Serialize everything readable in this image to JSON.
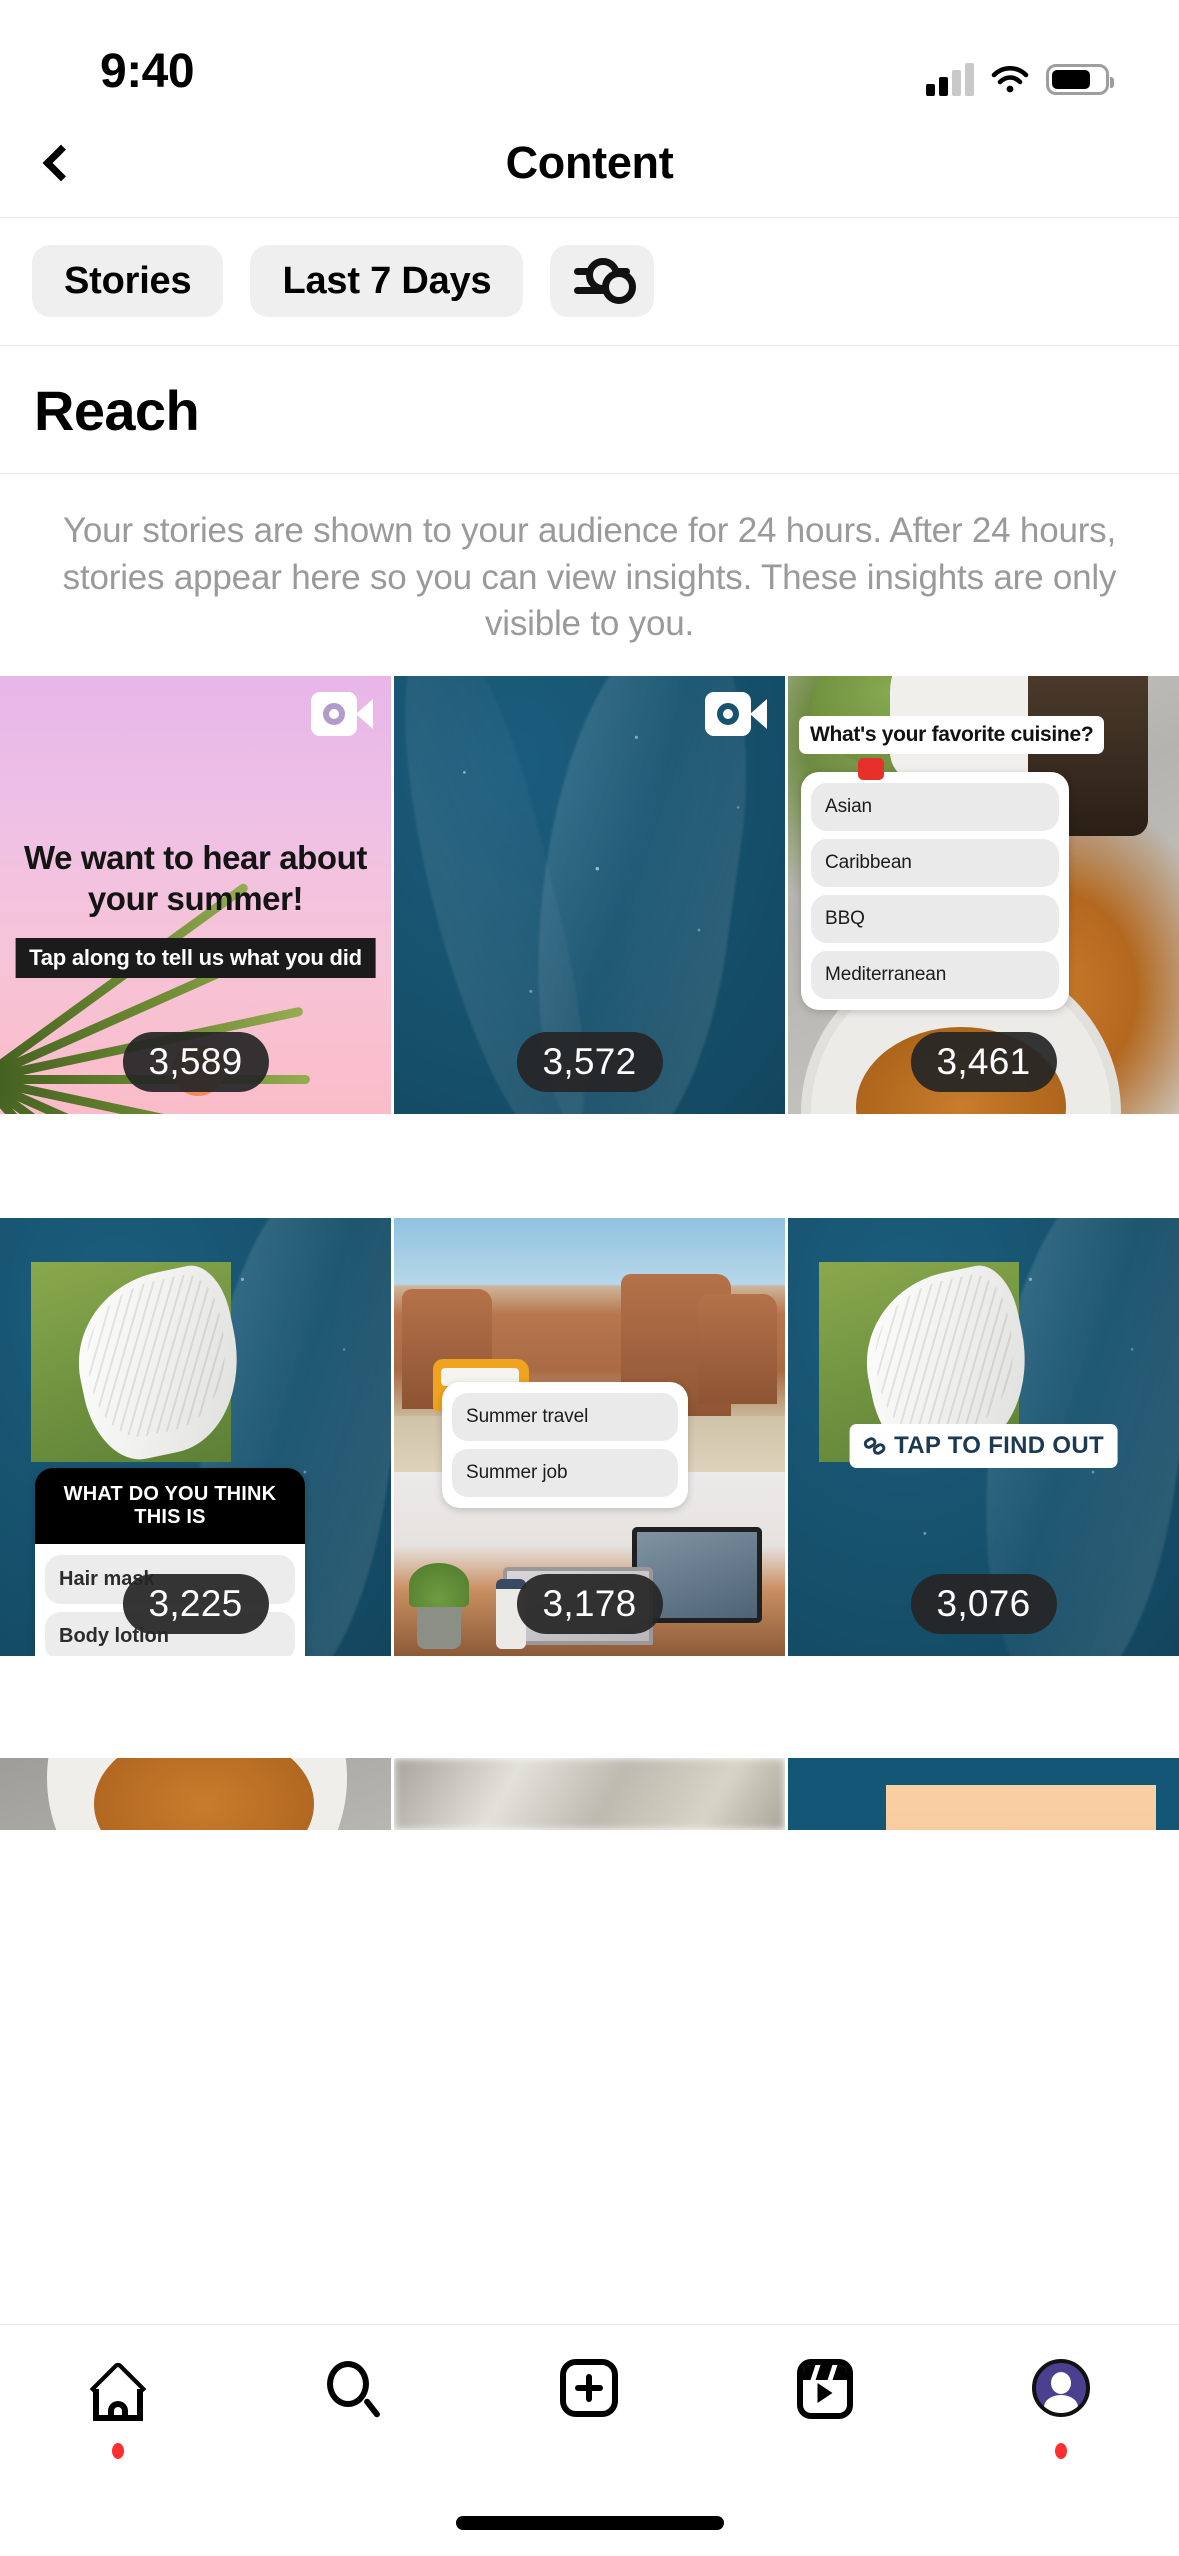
{
  "status_bar": {
    "time": "9:40",
    "signal_icon": "cellular-signal-icon",
    "wifi_icon": "wifi-icon",
    "battery_icon": "battery-icon"
  },
  "header": {
    "back_icon": "back-chevron-icon",
    "title": "Content"
  },
  "filters": {
    "content_type": "Stories",
    "time_range": "Last 7 Days",
    "settings_icon": "sliders-filter-icon"
  },
  "section": {
    "title": "Reach",
    "description": "Your stories are shown to your audience for 24 hours. After 24 hours, stories appear here so you can view insights. These insights are only visible to you."
  },
  "stories": [
    {
      "reach": "3,589",
      "has_video": true,
      "video_icon": "video-camera-icon",
      "headline": "We want to hear about your summer!",
      "subtitle": "Tap along to tell us what you did"
    },
    {
      "reach": "3,572",
      "has_video": true,
      "video_icon": "video-camera-icon"
    },
    {
      "reach": "3,461",
      "has_video": false,
      "poll_question": "What's your favorite cuisine?",
      "poll_options": [
        "Asian",
        "Caribbean",
        "BBQ",
        "Mediterranean"
      ]
    },
    {
      "reach": "3,225",
      "has_video": false,
      "quiz_question": "WHAT DO YOU THINK THIS IS",
      "quiz_options": [
        "Hair mask",
        "Body lotion"
      ]
    },
    {
      "reach": "3,178",
      "has_video": false,
      "poll_options": [
        "Summer travel",
        "Summer job"
      ]
    },
    {
      "reach": "3,076",
      "has_video": false,
      "link_label": "TAP TO FIND OUT",
      "link_icon": "chain-link-icon"
    }
  ],
  "tab_bar": {
    "items": [
      {
        "name": "home",
        "icon": "home-icon",
        "has_badge": true
      },
      {
        "name": "search",
        "icon": "search-icon",
        "has_badge": false
      },
      {
        "name": "create",
        "icon": "plus-square-icon",
        "has_badge": false
      },
      {
        "name": "reels",
        "icon": "reels-icon",
        "has_badge": false
      },
      {
        "name": "profile",
        "icon": "profile-avatar-icon",
        "has_badge": true
      }
    ]
  },
  "colors": {
    "chip_bg": "#efefef",
    "badge_bg": "#262626",
    "accent_red": "#ff2f2f",
    "muted_text": "#9a9a9a",
    "avatar_purple": "#4b3f8f"
  }
}
